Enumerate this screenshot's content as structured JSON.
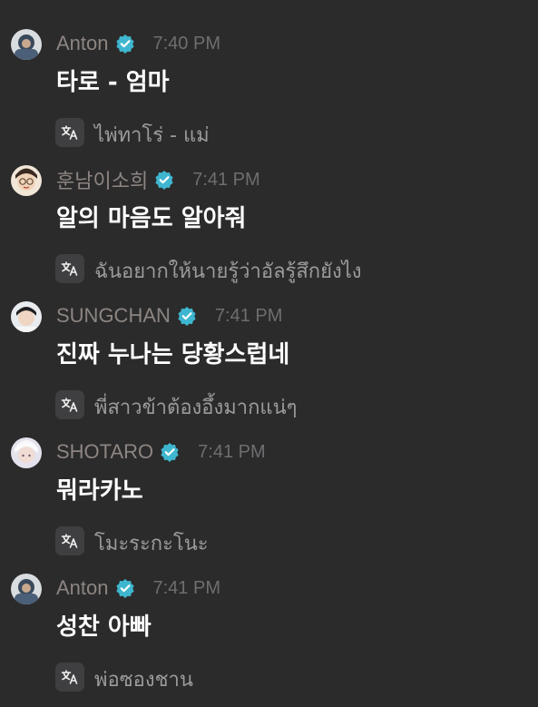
{
  "messages": [
    {
      "name": "Anton",
      "time": "7:40 PM",
      "text": "타로 - 엄마",
      "translation": "ไพ่ทาโร่ - แม่",
      "avatar": "anton-avatar"
    },
    {
      "name": "훈남이소희",
      "time": "7:41 PM",
      "text": "알의 마음도 알아줘",
      "translation": "ฉันอยากให้นายรู้ว่าอัลรู้สึกยังไง",
      "avatar": "sohee-avatar"
    },
    {
      "name": "SUNGCHAN",
      "time": "7:41 PM",
      "text": "진짜 누나는 당황스럽네",
      "translation": "พี่สาวข้าต้องอึ้งมากแน่ๆ",
      "avatar": "sungchan-avatar"
    },
    {
      "name": "SHOTARO",
      "time": "7:41 PM",
      "text": "뭐라카노",
      "translation": "โมะระกะโนะ",
      "avatar": "shotaro-avatar"
    },
    {
      "name": "Anton",
      "time": "7:41 PM",
      "text": "성찬 아빠",
      "translation": "พ่อซองชาน",
      "avatar": "anton-avatar"
    }
  ],
  "icons": {
    "verified": "verified-badge-icon",
    "translate": "translate-icon"
  },
  "colors": {
    "background": "#2b2b2c",
    "name": "#8d8581",
    "time": "#6e6e70",
    "message": "#ffffff",
    "translation": "#9b9b9d",
    "verified": "#3fb6cf",
    "translate_button": "#3f3f41"
  }
}
